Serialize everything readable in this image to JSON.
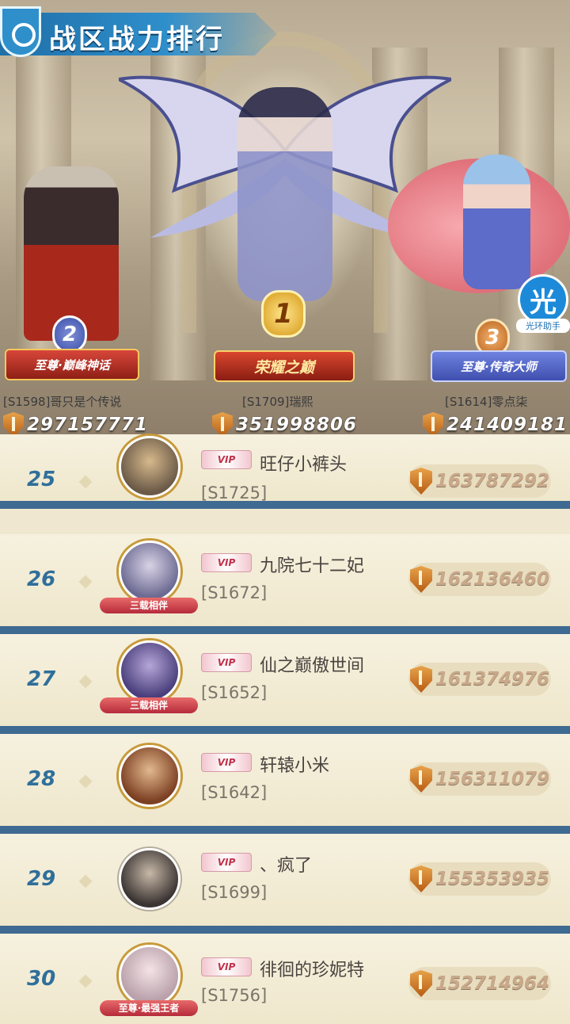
{
  "header": {
    "title": "战区战力排行"
  },
  "podium": [
    {
      "rank": "2",
      "title": "至尊·巅峰神话",
      "name": "[S1598]哥只是个传说",
      "power": "297157771"
    },
    {
      "rank": "1",
      "title": "荣耀之巅",
      "name": "[S1709]瑞熙",
      "power": "351998806"
    },
    {
      "rank": "3",
      "title": "至尊·传奇大师",
      "name": "[S1614]零点柒",
      "power": "241409181"
    }
  ],
  "assistant": {
    "icon": "光",
    "label": "光环助手"
  },
  "rows": [
    {
      "rank": "25",
      "vip": "VIP",
      "name": "旺仔小裤头",
      "server": "[S1725]",
      "power": "163787292",
      "frame_tag": ""
    },
    {
      "rank": "26",
      "vip": "VIP",
      "name": "九院七十二妃",
      "server": "[S1672]",
      "power": "162136460",
      "frame_tag": "三载相伴"
    },
    {
      "rank": "27",
      "vip": "VIP",
      "name": "仙之巅傲世间",
      "server": "[S1652]",
      "power": "161374976",
      "frame_tag": "三载相伴"
    },
    {
      "rank": "28",
      "vip": "VIP",
      "name": "轩辕小米",
      "server": "[S1642]",
      "power": "156311079",
      "frame_tag": ""
    },
    {
      "rank": "29",
      "vip": "VIP",
      "name": "、疯了",
      "server": "[S1699]",
      "power": "155353935",
      "frame_tag": ""
    },
    {
      "rank": "30",
      "vip": "VIP",
      "name": "徘徊的珍妮特",
      "server": "[S1756]",
      "power": "152714964",
      "frame_tag": "至尊·最强王者"
    }
  ],
  "colors": {
    "accent": "#2f8fcb",
    "list_divider": "#3f6a92",
    "rank_number": "#2f6f9a",
    "gold": "#d69a1a"
  }
}
